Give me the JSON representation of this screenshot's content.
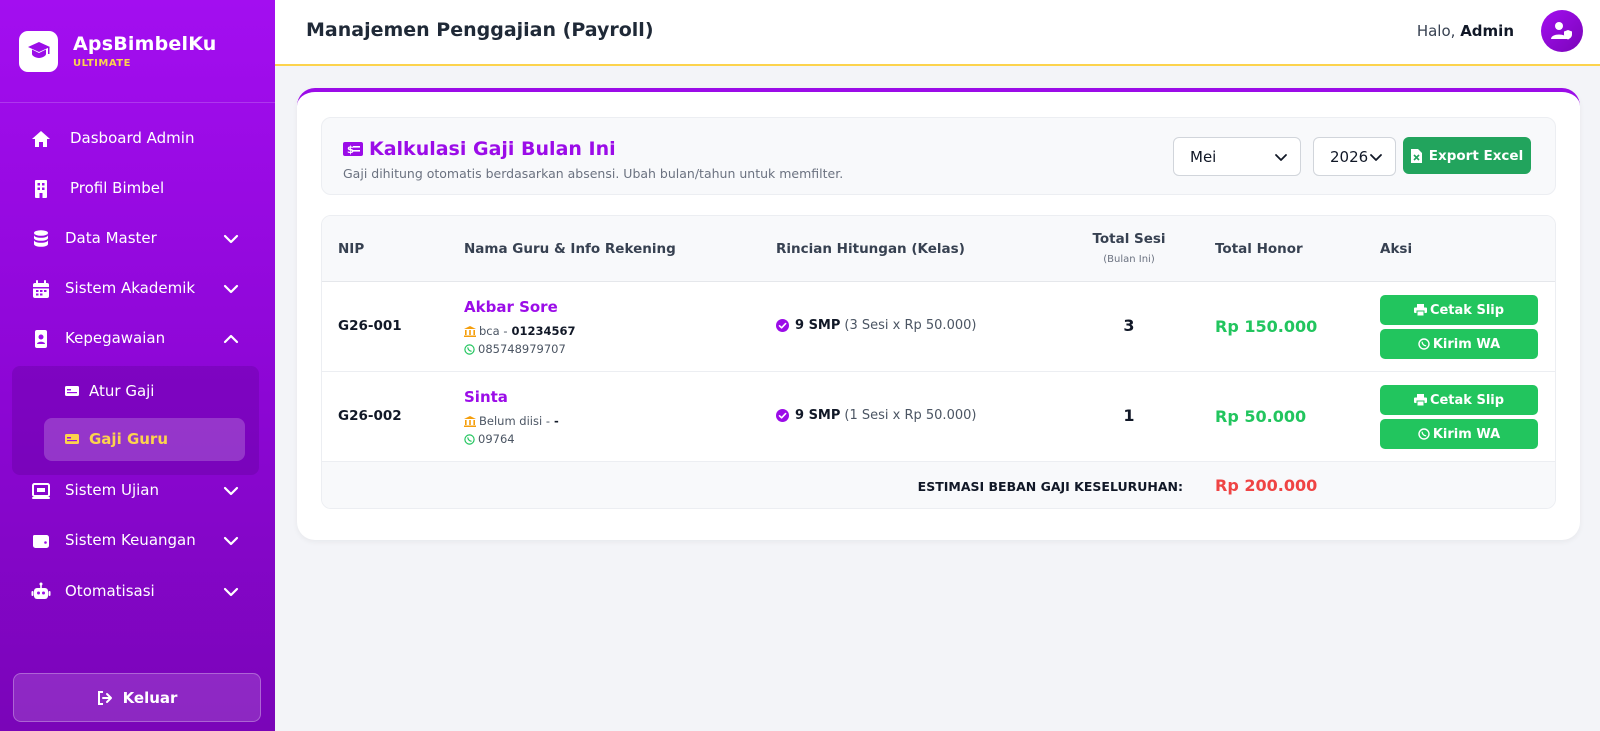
{
  "brand": {
    "name": "ApsBimbelKu",
    "tag": "ULTIMATE"
  },
  "sidebar": {
    "items": [
      {
        "label": "Dasboard Admin",
        "icon": "home-icon"
      },
      {
        "label": "Profil Bimbel",
        "icon": "building-icon"
      },
      {
        "label": "Data Master",
        "icon": "database-icon",
        "expandable": true,
        "expanded": false
      },
      {
        "label": "Sistem Akademik",
        "icon": "calendar-icon",
        "expandable": true,
        "expanded": false
      },
      {
        "label": "Kepegawaian",
        "icon": "id-badge-icon",
        "expandable": true,
        "expanded": true
      },
      {
        "label": "Sistem Ujian",
        "icon": "laptop-icon",
        "expandable": true,
        "expanded": false
      },
      {
        "label": "Sistem Keuangan",
        "icon": "wallet-icon",
        "expandable": true,
        "expanded": false
      },
      {
        "label": "Otomatisasi",
        "icon": "robot-icon",
        "expandable": true,
        "expanded": false
      }
    ],
    "subitems": [
      {
        "label": "Atur Gaji",
        "icon": "money-card-icon",
        "active": false
      },
      {
        "label": "Gaji Guru",
        "icon": "money-card-icon",
        "active": true
      }
    ],
    "logout_label": "Keluar"
  },
  "header": {
    "title": "Manajemen Penggajian (Payroll)",
    "greeting": "Halo,",
    "user": "Admin"
  },
  "panel": {
    "title": "Kalkulasi Gaji Bulan Ini",
    "description": "Gaji dihitung otomatis berdasarkan absensi. Ubah bulan/tahun untuk memfilter.",
    "month": "Mei",
    "year": "2026",
    "export_label": "Export Excel"
  },
  "table": {
    "columns": {
      "nip": "NIP",
      "name": "Nama Guru & Info Rekening",
      "rincian": "Rincian Hitungan (Kelas)",
      "sesi": "Total Sesi",
      "sesi_sub": "(Bulan Ini)",
      "honor": "Total Honor",
      "aksi": "Aksi"
    },
    "rows": [
      {
        "nip": "G26-001",
        "name": "Akbar Sore",
        "bank": "bca -",
        "account": "01234567",
        "phone": "085748979707",
        "kelas": "9 SMP",
        "detail": "(3 Sesi x Rp 50.000)",
        "sesi": "3",
        "honor": "Rp 150.000"
      },
      {
        "nip": "G26-002",
        "name": "Sinta",
        "bank": "Belum diisi -",
        "account": "-",
        "phone": "09764",
        "kelas": "9 SMP",
        "detail": "(1 Sesi x Rp 50.000)",
        "sesi": "1",
        "honor": "Rp 50.000"
      }
    ],
    "slip_label": "Cetak Slip",
    "wa_label": "Kirim WA",
    "total_label": "ESTIMASI BEBAN GAJI KESELURUHAN:",
    "total_value": "Rp 200.000"
  },
  "colors": {
    "primary": "#9b0ce8",
    "accent": "#fcd34d",
    "success": "#22c55e",
    "export": "#22a45d",
    "danger": "#ef4444"
  }
}
